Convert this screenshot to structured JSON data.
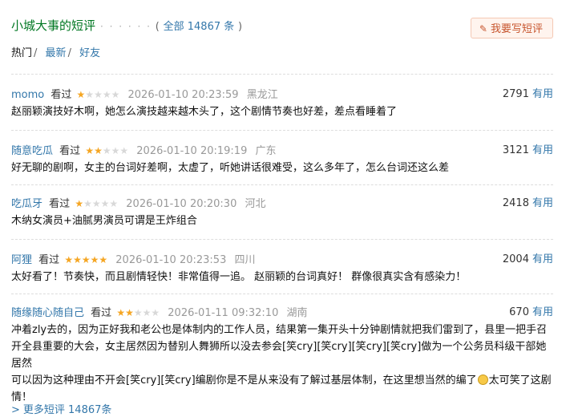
{
  "header": {
    "title": "小城大事的短评",
    "dots": "· · · · · ·",
    "count_open": "(",
    "count_text": "全部 14867 条",
    "count_close": ")",
    "write_button": "我要写短评"
  },
  "tabs": [
    {
      "label": "热门",
      "active": true
    },
    {
      "label": "最新",
      "active": false
    },
    {
      "label": "好友",
      "active": false
    }
  ],
  "tab_separator": "/",
  "watched_label": "看过",
  "useful_label": "有用",
  "colors": {
    "link": "#3377aa",
    "star": "#f5a623",
    "title_green": "#007722",
    "write_button_text": "#c7552e"
  },
  "comments": [
    {
      "user": "momo",
      "rating": 1,
      "time": "2026-01-10 20:23:59",
      "location": "黑龙江",
      "votes": "2791",
      "content": "赵丽颖演技好木啊，她怎么演技越来越木头了，这个剧情节奏也好差，差点看睡着了"
    },
    {
      "user": "随意吃瓜",
      "rating": 2,
      "time": "2026-01-10 20:19:19",
      "location": "广东",
      "votes": "3121",
      "content": "好无聊的剧啊，女主的台词好差啊，太虚了，听她讲话很难受，这么多年了，怎么台词还这么差"
    },
    {
      "user": "吃瓜牙",
      "rating": 1,
      "time": "2026-01-10 20:20:30",
      "location": "河北",
      "votes": "2418",
      "content": "木纳女演员+油腻男演员可谓是王炸组合"
    },
    {
      "user": "阿狸",
      "rating": 5,
      "time": "2026-01-10 20:23:53",
      "location": "四川",
      "votes": "2004",
      "content": "太好看了！节奏快，而且剧情轻快！非常值得一追。 赵丽颖的台词真好！ 群像很真实含有感染力！"
    },
    {
      "user": "随缘随心随自己",
      "rating": 2,
      "time": "2026-01-11 09:32:10",
      "location": "湖南",
      "votes": "670",
      "content_lines": [
        "冲着zly去的，因为正好我和老公也是体制内的工作人员，结果第一集开头十分钟剧情就把我们雷到了，县里一把手召",
        "开全县重要的大会，女主居然因为替别人舞狮所以没去参会[笑cry][笑cry][笑cry][笑cry]做为一个公务员科级干部她居然",
        "可以因为这种理由不开会[笑cry][笑cry]编剧你是不是从来没有了解过基层体制，在这里想当然的编了",
        "太可笑了这剧",
        "情！"
      ]
    }
  ],
  "more_link": "更多短评 14867条",
  "more_caret": ">"
}
